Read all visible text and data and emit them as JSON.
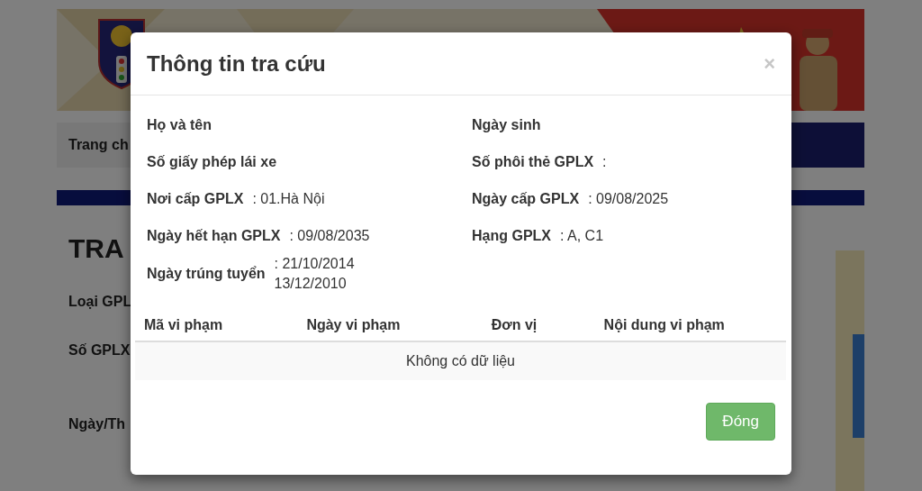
{
  "background": {
    "nav_item": "Trang ch",
    "heading": "TRA",
    "form_labels": [
      "Loại GPL",
      "Số GPLX",
      "Ngày/Th"
    ]
  },
  "dialog": {
    "title": "Thông tin tra cứu",
    "close": "×",
    "fields": [
      {
        "label": "Họ và tên"
      },
      {
        "label": "Ngày sinh"
      },
      {
        "label": "Số giấy phép lái xe"
      },
      {
        "label": "Số phôi thẻ GPLX",
        "value_lines": [
          ":"
        ]
      },
      {
        "label": "Nơi cấp GPLX",
        "value_lines": [
          ": 01.Hà Nội"
        ]
      },
      {
        "label": "Ngày cấp GPLX",
        "value_lines": [
          ": 09/08/2025"
        ]
      },
      {
        "label": "Ngày hết hạn GPLX",
        "value_lines": [
          ": 09/08/2035"
        ]
      },
      {
        "label": "Hạng GPLX",
        "value_lines": [
          ": A, C1"
        ]
      },
      {
        "label": "Ngày trúng tuyển",
        "value_lines": [
          ": 21/10/2014",
          "13/12/2010"
        ]
      }
    ],
    "table": {
      "columns": [
        "Mã vi phạm",
        "Ngày vi phạm",
        "Đơn vị",
        "Nội dung vi phạm"
      ],
      "empty_message": "Không có dữ liệu"
    },
    "buttons": [
      "Đóng"
    ]
  }
}
